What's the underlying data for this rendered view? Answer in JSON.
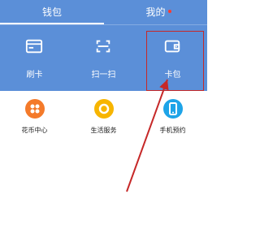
{
  "tabs": {
    "wallet": "钱包",
    "mine": "我的"
  },
  "top_actions": [
    {
      "label": "刷卡",
      "icon": "card-icon"
    },
    {
      "label": "扫一扫",
      "icon": "scan-icon"
    },
    {
      "label": "卡包",
      "icon": "wallet-icon"
    }
  ],
  "services": [
    {
      "label": "花币中心",
      "icon": "coin-center-icon",
      "color": "#f47a2a"
    },
    {
      "label": "生活服务",
      "icon": "life-service-icon",
      "color": "#f7b500"
    },
    {
      "label": "手机预约",
      "icon": "phone-booking-icon",
      "color": "#1ea4e8"
    }
  ],
  "colors": {
    "header": "#5b8fd8",
    "highlight": "#c62828",
    "badge": "#ff3b30"
  }
}
